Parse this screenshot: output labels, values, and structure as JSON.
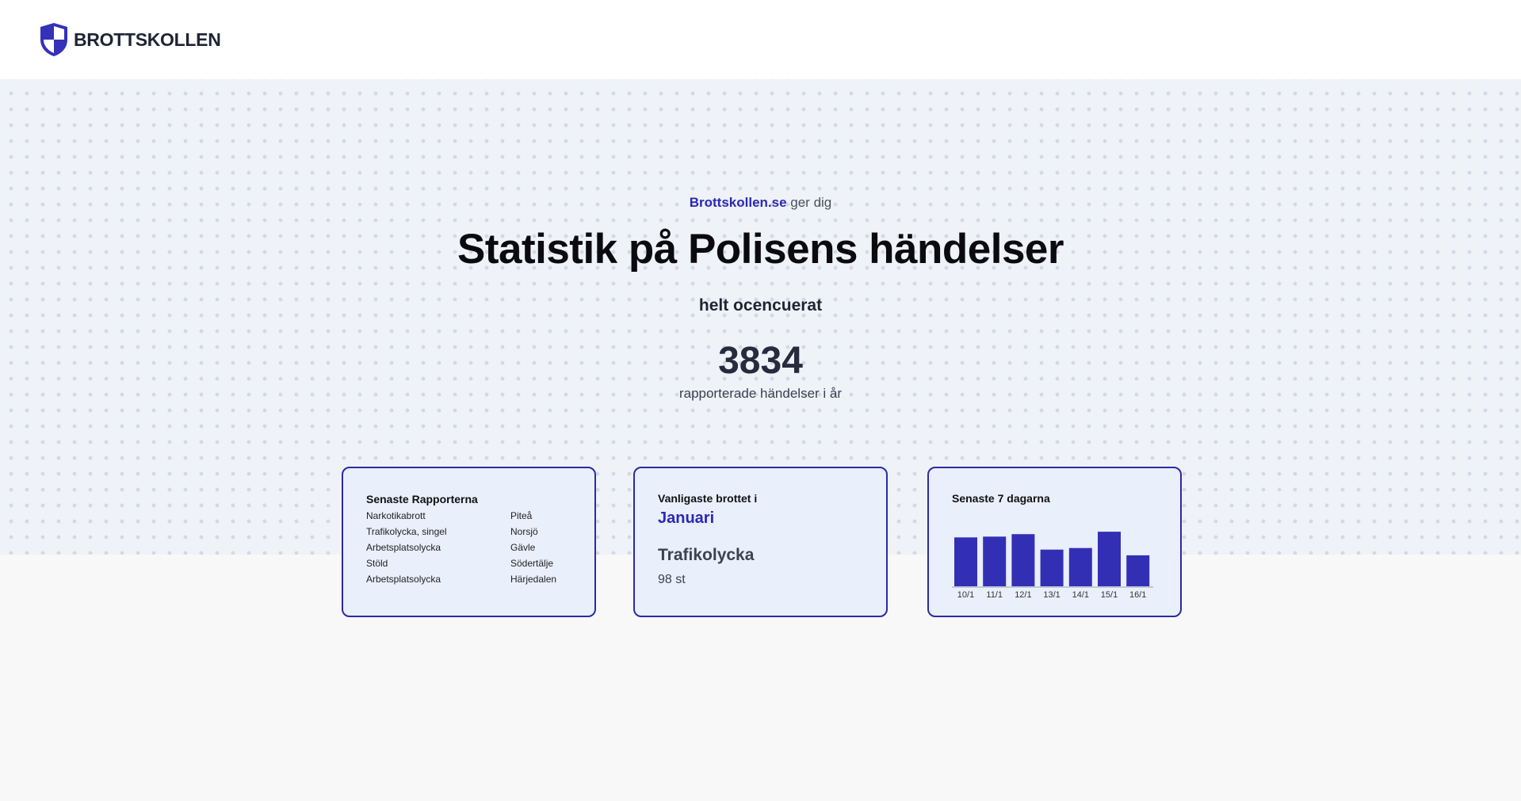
{
  "header": {
    "logo_text": "BROTTSKOLLEN"
  },
  "hero": {
    "brand": "Brottskollen.se",
    "tagline_rest": " ger dig",
    "title": "Statistik på Polisens händelser",
    "subtitle": "helt ocencuerat",
    "count": "3834",
    "count_label": "rapporterade händelser i år"
  },
  "latest_reports": {
    "title": "Senaste Rapporterna",
    "rows": [
      {
        "crime": "Narkotikabrott",
        "place": "Piteå"
      },
      {
        "crime": "Trafikolycka, singel",
        "place": "Norsjö"
      },
      {
        "crime": "Arbetsplatsolycka",
        "place": "Gävle"
      },
      {
        "crime": "Stöld",
        "place": "Södertälje"
      },
      {
        "crime": "Arbetsplatsolycka",
        "place": "Härjedalen"
      }
    ]
  },
  "common_crime": {
    "title": "Vanligaste brottet i",
    "month": "Januari",
    "crime": "Trafikolycka",
    "count": "98 st"
  },
  "last_seven": {
    "title": "Senaste 7 dagarna"
  },
  "colors": {
    "accent": "#2b28b5",
    "bar": "#332fb5",
    "card_bg": "#e9effb",
    "card_border": "#2c2aa5"
  },
  "chart_data": {
    "type": "bar",
    "title": "Senaste 7 dagarna",
    "categories": [
      "10/1",
      "11/1",
      "12/1",
      "13/1",
      "14/1",
      "15/1",
      "16/1"
    ],
    "values": [
      60,
      61,
      64,
      45,
      47,
      67,
      38
    ],
    "ylim": [
      0,
      70
    ],
    "grid": false,
    "legend": "none"
  }
}
